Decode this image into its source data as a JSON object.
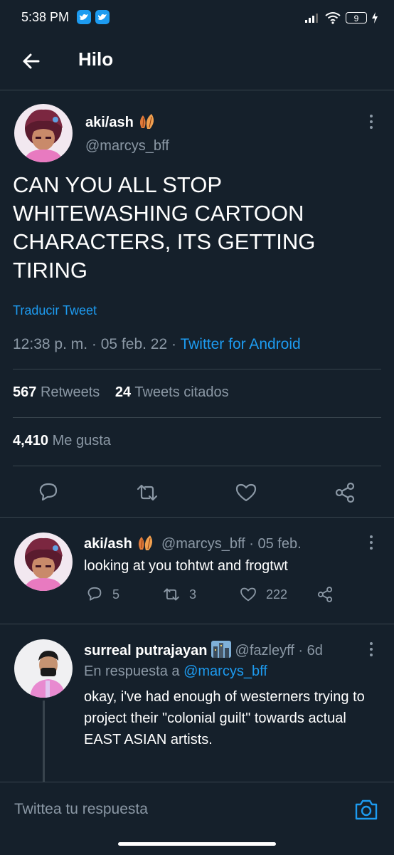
{
  "status_bar": {
    "time": "5:38 PM",
    "battery": "9"
  },
  "header": {
    "title": "Hilo"
  },
  "main_tweet": {
    "name": "aki/ash",
    "handle": "@marcys_bff",
    "text": "CAN YOU ALL STOP WHITEWASHING CARTOON CHARACTERS, ITS GETTING TIRING",
    "translate": "Traducir Tweet",
    "time": "12:38 p. m.",
    "date": "05 feb. 22",
    "source": "Twitter for Android",
    "retweets_count": "567",
    "retweets_label": "Retweets",
    "quotes_count": "24",
    "quotes_label": "Tweets citados",
    "likes_count": "4,410",
    "likes_label": "Me gusta"
  },
  "reply1": {
    "name": "aki/ash",
    "handle": "@marcys_bff",
    "date": "05 feb.",
    "text": "looking at you tohtwt and frogtwt",
    "replies": "5",
    "retweets": "3",
    "likes": "222"
  },
  "reply2": {
    "name": "surreal putrajayan",
    "handle": "@fazleyff",
    "age": "6d",
    "in_reply_label": "En respuesta a",
    "in_reply_handle": "@marcys_bff",
    "text": "okay, i've had enough of westerners trying to project their \"colonial guilt\" towards actual EAST ASIAN artists."
  },
  "compose": {
    "placeholder": "Twittea tu respuesta"
  },
  "colors": {
    "background": "#15202b",
    "accent": "#1d9bf0",
    "muted": "#8b98a5",
    "divider": "#38444d"
  }
}
